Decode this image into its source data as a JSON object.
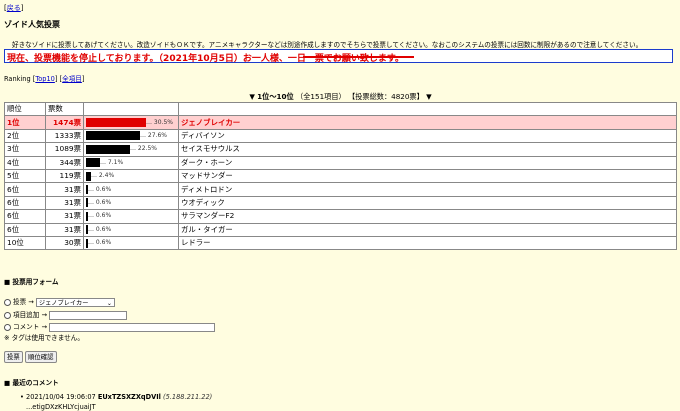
{
  "nav": {
    "back_link": "戻る"
  },
  "page_title": "ゾイド人気投票",
  "intro_text": "好きなゾイドに投票してあげてください。改造ゾイドもＯＫです。アニメキャラクターなどは別途作成しますのでそちらで投票してください。なおこのシステムの投票には回数に制限があるので注意してください。",
  "notice_text": "現在、投票機能を停止しております。（2021年10月5日）お一人様、一日一票でお願い致します。",
  "ranking": {
    "label": "Ranking",
    "top10_link": "Top10",
    "all_link": "全項目"
  },
  "rank_heading": {
    "left_arrow": "▼",
    "range": "1位～10位",
    "total_items": "（全151項目）",
    "total_votes": "【投票総数：4820票】",
    "right_arrow": "▼"
  },
  "table": {
    "headers": [
      "順位",
      "票数",
      "",
      ""
    ],
    "rows": [
      {
        "rank": "1位",
        "votes": "1474票",
        "share": 30.5,
        "pct": "… 30.5%",
        "name": "ジェノブレイカー"
      },
      {
        "rank": "2位",
        "votes": "1333票",
        "share": 27.6,
        "pct": "… 27.6%",
        "name": "ディバイソン"
      },
      {
        "rank": "3位",
        "votes": "1089票",
        "share": 22.5,
        "pct": "… 22.5%",
        "name": "セイスモサウルス"
      },
      {
        "rank": "4位",
        "votes": "344票",
        "share": 7.1,
        "pct": "… 7.1%",
        "name": "ダーク・ホーン"
      },
      {
        "rank": "5位",
        "votes": "119票",
        "share": 2.4,
        "pct": "… 2.4%",
        "name": "マッドサンダー"
      },
      {
        "rank": "6位",
        "votes": "31票",
        "share": 0.6,
        "pct": "… 0.6%",
        "name": "ディメトロドン"
      },
      {
        "rank": "6位",
        "votes": "31票",
        "share": 0.6,
        "pct": "… 0.6%",
        "name": "ウオディック"
      },
      {
        "rank": "6位",
        "votes": "31票",
        "share": 0.6,
        "pct": "… 0.6%",
        "name": "サラマンダーF2"
      },
      {
        "rank": "6位",
        "votes": "31票",
        "share": 0.6,
        "pct": "… 0.6%",
        "name": "ガル・タイガー"
      },
      {
        "rank": "10位",
        "votes": "30票",
        "share": 0.6,
        "pct": "… 0.6%",
        "name": "レドラー"
      }
    ]
  },
  "vote_form": {
    "title": "■ 投票用フォーム",
    "vote_label": "投票 →",
    "vote_selected": "ジェノブレイカー",
    "add_item_label": "項目追加 →",
    "add_item_value": "",
    "comment_label": "コメント →",
    "comment_value": "",
    "tag_note": "※ タグは使用できません。",
    "vote_button": "投票",
    "confirm_button": "順位確認"
  },
  "comments": {
    "title": "■ 最近のコメント",
    "items": [
      {
        "bullet": "•",
        "datetime": "2021/10/04 19:06:07",
        "user": "EUxTZSXZXqDVIl",
        "ip": "(5.188.211.22)",
        "body": "...etigDXzKHLYcjuaiJT"
      }
    ]
  },
  "colors": {
    "background": "#fffde0",
    "accent_red": "#e00000",
    "highlight_row": "#ffd0d0",
    "link": "#0000cc",
    "notice_border": "#1c3ccc"
  }
}
